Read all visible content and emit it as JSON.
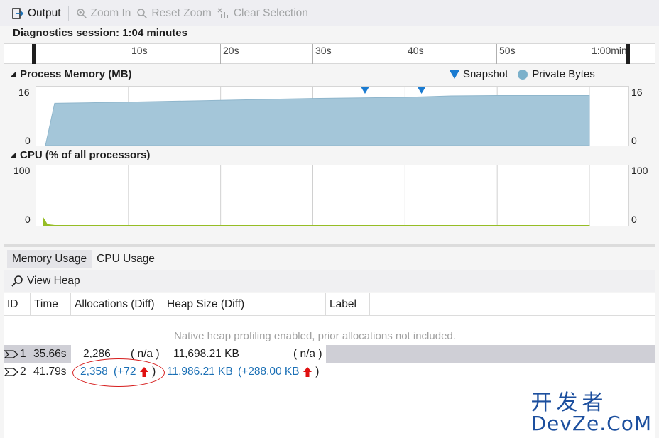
{
  "toolbar": {
    "output_label": "Output",
    "zoom_in_label": "Zoom In",
    "reset_zoom_label": "Reset Zoom",
    "clear_selection_label": "Clear Selection"
  },
  "session": {
    "label": "Diagnostics session: 1:04 minutes"
  },
  "ruler": {
    "ticks": [
      "10s",
      "20s",
      "30s",
      "40s",
      "50s",
      "1:00min"
    ]
  },
  "memory_graph": {
    "title": "Process Memory (MB)",
    "y_max": "16",
    "y_min": "0",
    "legend_snapshot": "Snapshot",
    "legend_private_bytes": "Private Bytes",
    "series_color": "#a4c6d9",
    "snapshot_color": "#1a7bd1"
  },
  "cpu_graph": {
    "title": "CPU (% of all processors)",
    "y_max": "100",
    "y_min": "0",
    "series_color": "#96bd25"
  },
  "tabs": {
    "memory_usage": "Memory Usage",
    "cpu_usage": "CPU Usage"
  },
  "subtoolbar": {
    "view_heap_label": "View Heap"
  },
  "table": {
    "headers": {
      "id": "ID",
      "time": "Time",
      "allocations": "Allocations (Diff)",
      "heap_size": "Heap Size (Diff)",
      "label": "Label"
    },
    "note": "Native heap profiling enabled, prior allocations not included.",
    "rows": [
      {
        "id": "1",
        "time": "35.66s",
        "allocations": "2,286",
        "alloc_diff": "( n/a )",
        "heap_size": "11,698.21 KB",
        "heap_diff": "( n/a )"
      },
      {
        "id": "2",
        "time": "41.79s",
        "allocations": "2,358",
        "alloc_diff_open": "(+72",
        "alloc_diff_close": ")",
        "heap_size": "11,986.21 KB",
        "heap_diff_open": "(+288.00 KB",
        "heap_diff_close": ")"
      }
    ]
  },
  "watermark": {
    "line1": "开发者",
    "line2": "DevZe.CoM"
  },
  "chart_data": [
    {
      "type": "area",
      "title": "Process Memory (MB)",
      "ylim": [
        0,
        16
      ],
      "x_seconds": [
        1,
        2,
        10,
        20,
        30,
        40,
        45,
        50,
        60
      ],
      "series": [
        {
          "name": "Private Bytes",
          "values": [
            0,
            11.5,
            11.8,
            12.3,
            12.8,
            13.1,
            13.5,
            13.6,
            13.6
          ]
        }
      ],
      "snapshots_seconds": [
        35.66,
        41.79
      ],
      "grid": true
    },
    {
      "type": "area",
      "title": "CPU (% of all processors)",
      "ylim": [
        0,
        100
      ],
      "x_seconds": [
        0.8,
        1.2,
        2,
        60
      ],
      "series": [
        {
          "name": "CPU",
          "values": [
            12,
            2,
            0.6,
            0.6
          ]
        }
      ],
      "grid": true
    }
  ]
}
